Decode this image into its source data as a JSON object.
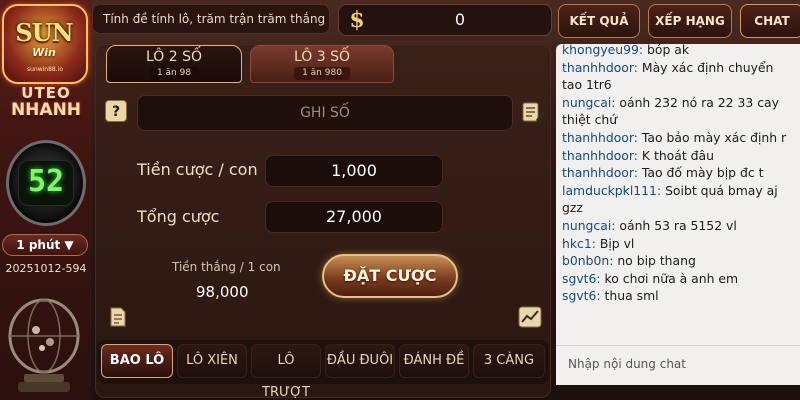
{
  "brand": {
    "logo_text": "SUN",
    "logo_sub": "Win",
    "logo_url": "sunwin88.io",
    "game_title_line1": "UTEO",
    "game_title_line2": "NHANH"
  },
  "timer": {
    "value": "52"
  },
  "period": {
    "label": "1 phút ▼"
  },
  "session": {
    "id": "20251012-594"
  },
  "top_bar": {
    "tagline": "Tính đề tính lô, trăm trận trăm thắng",
    "currency_symbol": "$",
    "balance": "0",
    "results_label": "KẾT QUẢ",
    "ranking_label": "XẾP HẠNG",
    "chat_label": "CHAT"
  },
  "number_tabs": [
    {
      "label": "LÔ 2 SỐ",
      "sub": "1 ăn 98",
      "active": true
    },
    {
      "label": "LÔ 3 SỐ",
      "sub": "1 ăn 980",
      "active": false
    }
  ],
  "bet_form": {
    "help_icon": "?",
    "number_placeholder": "GHI SỐ",
    "bet_label": "Tiền cược / con",
    "bet_value": "1,000",
    "total_label": "Tổng cược",
    "total_value": "27,000",
    "win_label": "Tiền thắng / 1 con",
    "win_value": "98,000",
    "place_bet_label": "ĐẶT CƯỢC"
  },
  "bet_types": [
    {
      "label": "BAO LÔ",
      "active": true
    },
    {
      "label": "LÔ XIÊN",
      "active": false
    },
    {
      "label": "LÔ TRƯỢT",
      "active": false
    },
    {
      "label": "ĐẦU ĐUÔI",
      "active": false
    },
    {
      "label": "ĐÁNH ĐỀ",
      "active": false
    },
    {
      "label": "3 CÀNG",
      "active": false
    }
  ],
  "chat": {
    "messages": [
      {
        "user": "khongyeu99:",
        "text": " bóp ak"
      },
      {
        "user": "thanhhdoor:",
        "text": " Mày xác định chuyển tao 1tr6"
      },
      {
        "user": "nungcai:",
        "text": " oánh 232 nó ra 22 33 cay thiệt chứ"
      },
      {
        "user": "thanhhdoor:",
        "text": " Tao bảo mày xác định r"
      },
      {
        "user": "thanhhdoor:",
        "text": " K thoát đâu"
      },
      {
        "user": "thanhhdoor:",
        "text": " Tao đố mày bịp đc t"
      },
      {
        "user": "lamduckpkl111:",
        "text": " Soibt quá bmay aj gzz"
      },
      {
        "user": "nungcai:",
        "text": " oánh 53 ra 5152 vl"
      },
      {
        "user": "hkc1:",
        "text": " Bịp vl"
      },
      {
        "user": "b0nb0n:",
        "text": " no bip thang"
      },
      {
        "user": "sgvt6:",
        "text": " ko chơi nữa à anh em"
      },
      {
        "user": "sgvt6:",
        "text": " thua sml"
      }
    ],
    "input_placeholder": "Nhập nội dung chat"
  },
  "colors": {
    "accent_gold": "#e6b26a",
    "panel_dark": "#2a1711",
    "timer_green": "#7cf76a",
    "chat_username": "#144c7a"
  }
}
